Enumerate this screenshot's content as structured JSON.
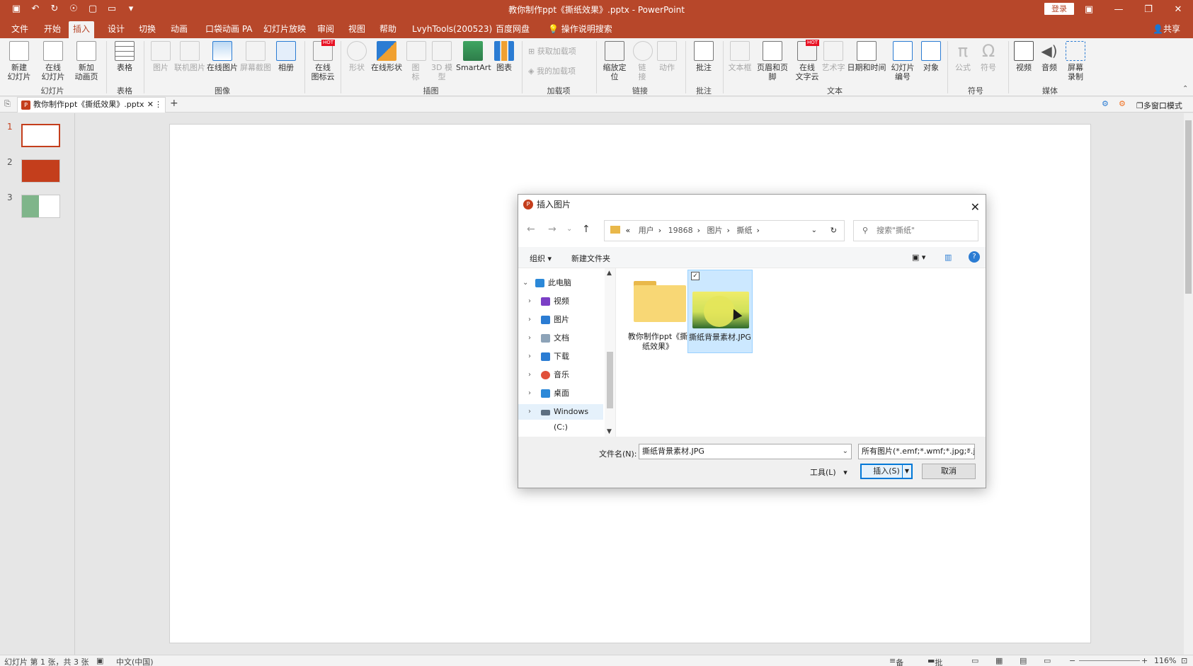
{
  "titlebar": {
    "title": "教你制作ppt《撕纸效果》.pptx - PowerPoint",
    "login": "登录",
    "qat_icons": [
      "save-icon",
      "undo-icon",
      "redo-icon",
      "touch-mode-icon",
      "new-file-icon",
      "open-folder-icon",
      "customize-icon"
    ],
    "window_controls": [
      "ribbon-display-icon",
      "minimize-icon",
      "restore-icon",
      "close-icon"
    ]
  },
  "menu": {
    "tabs": [
      "文件",
      "开始",
      "插入",
      "设计",
      "切换",
      "动画",
      "口袋动画 PA",
      "幻灯片放映",
      "审阅",
      "视图",
      "帮助",
      "LvyhTools(200523)",
      "百度网盘",
      "操作说明搜索"
    ],
    "active": "插入",
    "share": "共享"
  },
  "ribbon": {
    "buttons": {
      "new_slide": "新建\n幻灯片",
      "online_slide": "在线\n幻灯片",
      "new_anim_page": "新加\n动画页",
      "table": "表格",
      "picture": "图片",
      "online_picture": "联机图片",
      "online_image": "在线图片",
      "screenshot": "屏幕截图",
      "album": "相册",
      "online_icon_cloud": "在线\n图标云",
      "shapes": "形状",
      "online_shapes": "在线形状",
      "icons": "图\n标",
      "model3d": "3D 模\n型",
      "smartart": "SmartArt",
      "chart": "图表",
      "get_addins": "获取加载项",
      "my_addins": "我的加载项",
      "zoom": "缩放定\n位",
      "link": "链\n接",
      "action": "动作",
      "comment": "批注",
      "textbox": "文本框",
      "header_footer": "页眉和页脚",
      "online_text_cloud": "在线\n文字云",
      "wordart": "艺术字",
      "datetime": "日期和时间",
      "slide_number": "幻灯片\n编号",
      "object": "对象",
      "equation": "公式",
      "symbol": "符号",
      "video": "视频",
      "audio": "音频",
      "screen_record": "屏幕\n录制",
      "hot": "HOT"
    },
    "groups": [
      "幻灯片",
      "表格",
      "图像",
      "插图",
      "加载项",
      "链接",
      "批注",
      "文本",
      "符号",
      "媒体"
    ]
  },
  "doctabs": {
    "file_tab": "教你制作ppt《撕纸效果》.pptx",
    "multi_window": "多窗口模式"
  },
  "slides": {
    "numbers": [
      "1",
      "2",
      "3"
    ]
  },
  "dialog": {
    "title": "插入图片",
    "breadcrumb": [
      "«",
      "用户",
      "19868",
      "图片",
      "撕纸"
    ],
    "search_placeholder": "搜索\"撕纸\"",
    "toolbar": {
      "organize": "组织",
      "new_folder": "新建文件夹"
    },
    "nav": [
      {
        "label": "此电脑",
        "icon": "computer-icon",
        "color": "#2b88d8"
      },
      {
        "label": "视频",
        "icon": "video-folder-icon",
        "color": "#7b3fc6"
      },
      {
        "label": "图片",
        "icon": "pictures-folder-icon",
        "color": "#2b7cd3"
      },
      {
        "label": "文档",
        "icon": "documents-folder-icon",
        "color": "#8da3b8"
      },
      {
        "label": "下载",
        "icon": "downloads-folder-icon",
        "color": "#2b7cd3"
      },
      {
        "label": "音乐",
        "icon": "music-folder-icon",
        "color": "#e0503a"
      },
      {
        "label": "桌面",
        "icon": "desktop-folder-icon",
        "color": "#2b88d8"
      },
      {
        "label": "Windows (C:)",
        "icon": "drive-icon",
        "color": "#5e6f80"
      }
    ],
    "files": [
      {
        "label": "教你制作ppt《撕纸效果》",
        "type": "folder"
      },
      {
        "label": "撕纸背景素材.JPG",
        "type": "image",
        "selected": true
      }
    ],
    "filename_label": "文件名(N):",
    "filename_value": "撕纸背景素材.JPG",
    "filetype_value": "所有图片(*.emf;*.wmf;*.jpg;*.jp",
    "tools": "工具(L)",
    "insert": "插入(S)",
    "cancel": "取消"
  },
  "status": {
    "slide_info": "幻灯片 第 1 张，共 3 张",
    "language": "中文(中国)",
    "notes": "备注",
    "comments": "批注",
    "zoom": "116%"
  },
  "colors": {
    "accent": "#b7472a",
    "selection": "#cce8ff"
  }
}
